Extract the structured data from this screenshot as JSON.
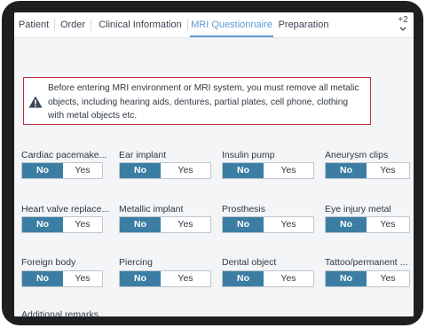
{
  "tabs": [
    {
      "label": "Patient"
    },
    {
      "label": "Order"
    },
    {
      "label": "Clinical Information"
    },
    {
      "label": "MRI Questionnaire",
      "active": true
    },
    {
      "label": "Preparation"
    }
  ],
  "more_tabs": {
    "label": "+2",
    "icon": "chevron-down-icon"
  },
  "warning": {
    "icon": "warning-triangle-icon",
    "text": "Before entering MRI environment or MRI system, you must remove all metalic objects, including hearing aids, dentures, partial plates, cell phone, clothing with metal objects etc."
  },
  "questions": [
    {
      "label": "Cardiac pacemake...",
      "no": "No",
      "yes": "Yes",
      "selected": "No"
    },
    {
      "label": "Ear implant",
      "no": "No",
      "yes": "Yes",
      "selected": "No"
    },
    {
      "label": "Insulin pump",
      "no": "No",
      "yes": "Yes",
      "selected": "No"
    },
    {
      "label": "Aneurysm clips",
      "no": "No",
      "yes": "Yes",
      "selected": "No"
    },
    {
      "label": "Heart valve replace...",
      "no": "No",
      "yes": "Yes",
      "selected": "No"
    },
    {
      "label": "Metallic implant",
      "no": "No",
      "yes": "Yes",
      "selected": "No"
    },
    {
      "label": "Prosthesis",
      "no": "No",
      "yes": "Yes",
      "selected": "No"
    },
    {
      "label": "Eye injury metal",
      "no": "No",
      "yes": "Yes",
      "selected": "No"
    },
    {
      "label": "Foreign body",
      "no": "No",
      "yes": "Yes",
      "selected": "No"
    },
    {
      "label": "Piercing",
      "no": "No",
      "yes": "Yes",
      "selected": "No"
    },
    {
      "label": "Dental object",
      "no": "No",
      "yes": "Yes",
      "selected": "No"
    },
    {
      "label": "Tattoo/permanent ...",
      "no": "No",
      "yes": "Yes",
      "selected": "No"
    }
  ],
  "additional_label": "Additional remarks",
  "colors": {
    "accent": "#5b9bd1",
    "no_selected": "#3c7ea3",
    "warning_border": "#c0303a"
  }
}
